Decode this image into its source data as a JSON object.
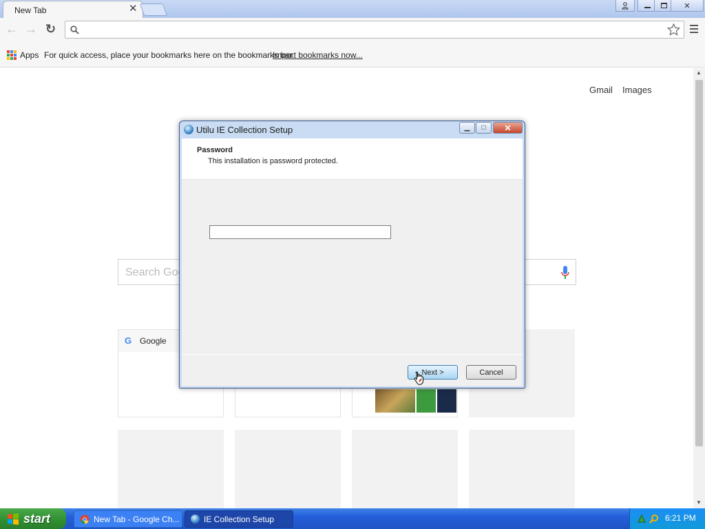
{
  "browser": {
    "tab_title": "New Tab",
    "tab_close": "✕",
    "omnibox_value": "",
    "apps_label": "Apps",
    "bookmarks_text": "For quick access, place your bookmarks here on the bookmarks bar.",
    "import_link": "Import bookmarks now...",
    "window_buttons": [
      "user",
      "minimize",
      "maximize",
      "close"
    ]
  },
  "page": {
    "gmail": "Gmail",
    "images": "Images",
    "search_placeholder": "Search Goo",
    "tile_google_label": "Google"
  },
  "dialog": {
    "title": "Utilu IE Collection Setup",
    "heading": "Password",
    "subheading": "This installation is password protected.",
    "password_value": "",
    "next_label": "Next >",
    "cancel_label": "Cancel"
  },
  "taskbar": {
    "start_label": "start",
    "tasks": [
      {
        "label": "New Tab - Google Ch..."
      },
      {
        "label": "IE Collection Setup"
      }
    ],
    "clock": "6:21 PM"
  },
  "colors": {
    "taskbar_blue": "#245edb",
    "start_green": "#3c9d3d",
    "dialog_frame": "#c9dcf3"
  }
}
